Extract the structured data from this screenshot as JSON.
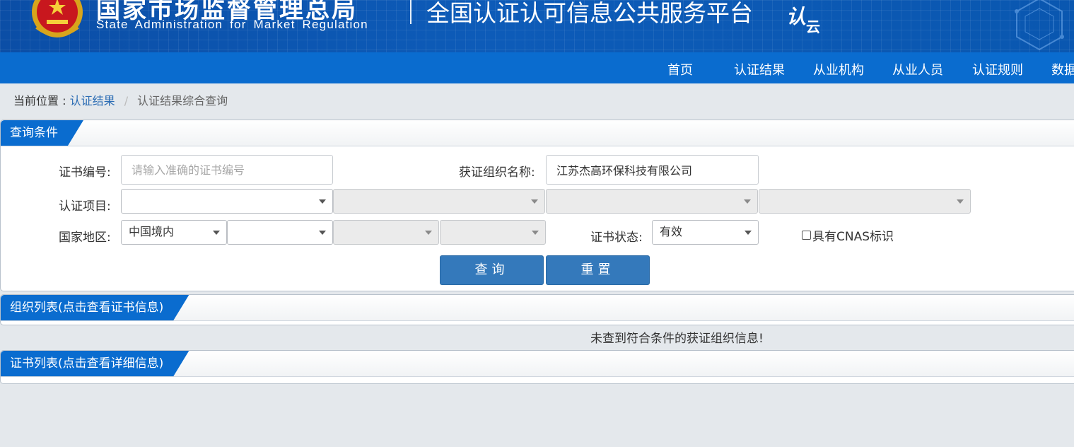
{
  "header": {
    "org_name_cn": "国家市场监督管理总局",
    "org_name_en": "State Administration for Market Regulation",
    "platform_title": "全国认证认可信息公共服务平台",
    "platform_logo": "认",
    "platform_logo_sub": "云"
  },
  "nav": {
    "items": [
      "首页",
      "认证结果",
      "从业机构",
      "从业人员",
      "认证规则",
      "数据"
    ]
  },
  "breadcrumb": {
    "prefix": "当前位置 :",
    "link": "认证结果",
    "separator": "/",
    "current": "认证结果综合查询"
  },
  "query_panel": {
    "title": "查询条件",
    "cert_number": {
      "label": "证书编号:",
      "placeholder": "请输入准确的证书编号",
      "value": ""
    },
    "org_name": {
      "label": "获证组织名称:",
      "value": "江苏杰高环保科技有限公司"
    },
    "cert_project": {
      "label": "认证项目:",
      "selects": [
        "",
        "",
        "",
        ""
      ]
    },
    "region": {
      "label": "国家地区:",
      "selects": [
        "中国境内",
        "",
        "",
        ""
      ]
    },
    "cert_status": {
      "label": "证书状态:",
      "value": "有效"
    },
    "cnas_checkbox": {
      "label": "具有CNAS标识",
      "checked": false
    },
    "search_button": "查询",
    "reset_button": "重置"
  },
  "org_list_panel": {
    "title": "组织列表(点击查看证书信息)",
    "empty_message": "未查到符合条件的获证组织信息!"
  },
  "cert_list_panel": {
    "title": "证书列表(点击查看详细信息)"
  },
  "colors": {
    "header_bg": "#0b4ea6",
    "nav_bg": "#0a6ccf",
    "button_bg": "#3479bb",
    "link": "#2b6cb4",
    "page_bg": "#e4e8ec"
  }
}
